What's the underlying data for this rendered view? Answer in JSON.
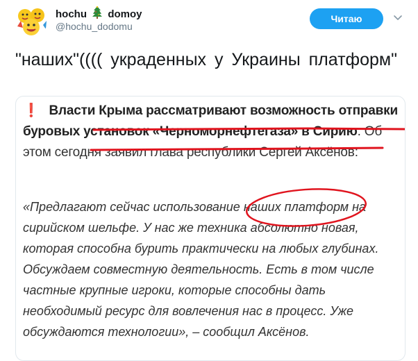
{
  "user": {
    "name_part1": "hochu",
    "name_part2": "domoy",
    "handle": "@hochu_dodomu",
    "tree_icon": "christmas-tree-icon",
    "avatar_icon": "emoji-faces-avatar"
  },
  "follow_button": {
    "label": "Читаю"
  },
  "menu_icon": "chevron-down-icon",
  "tweet": {
    "text": "\"наших\"(((( украденных у Украины платформ\""
  },
  "card": {
    "exclamation": "❗️",
    "headline_part1": "Власти Крыма рассматривают возможность отправки буровых установок «Черноморнефтегаза» в Сирию",
    "headline_part2": ". Об этом сегодня заявил глава республики Сергей Аксёнов:",
    "quote": "«Предлагают сейчас использование наших платформ на сирийском шельфе. У нас же техника абсолютно новая, которая способна бурить практически на любых глубинах. Обсуждаем совместную деятельность. Есть в том числе частные крупные игроки, которые способны дать необходимый ресурс для вовлечения нас в процесс. Уже обсуждаются технологии», – сообщил Аксёнов."
  },
  "colors": {
    "follow_button_bg": "#1da1f2",
    "annotation_red": "#e0141e",
    "handle_gray": "#657786"
  }
}
